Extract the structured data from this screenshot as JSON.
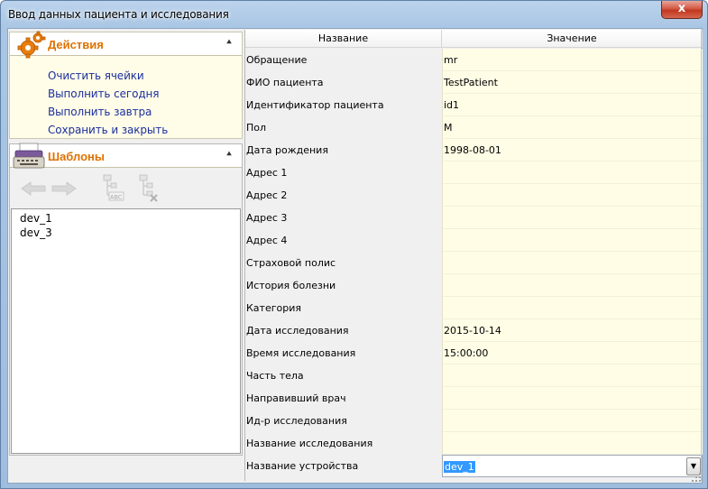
{
  "window": {
    "title": "Ввод данных пациента и исследования",
    "close_glyph": "x"
  },
  "actions": {
    "title": "Действия",
    "collapse_glyph": "⯅",
    "icon": "gears-icon",
    "items": [
      "Очистить ячейки",
      "Выполнить сегодня",
      "Выполнить завтра",
      "Сохранить и закрыть"
    ]
  },
  "templates": {
    "title": "Шаблоны",
    "collapse_glyph": "⯅",
    "icon": "typewriter-icon",
    "toolbar": [
      "back-arrow-icon",
      "forward-arrow-icon",
      "rename-template-icon",
      "delete-template-icon"
    ],
    "items": [
      "dev_1",
      "dev_3"
    ]
  },
  "grid": {
    "header_name": "Название",
    "header_value": "Значение",
    "rows": [
      {
        "name": "Обращение",
        "value": "mr"
      },
      {
        "name": "ФИО пациента",
        "value": "TestPatient"
      },
      {
        "name": "Идентификатор пациента",
        "value": "id1"
      },
      {
        "name": "Пол",
        "value": "M"
      },
      {
        "name": "Дата рождения",
        "value": "1998-08-01"
      },
      {
        "name": "Адрес 1",
        "value": ""
      },
      {
        "name": "Адрес 2",
        "value": ""
      },
      {
        "name": "Адрес 3",
        "value": ""
      },
      {
        "name": "Адрес 4",
        "value": ""
      },
      {
        "name": "Страховой полис",
        "value": ""
      },
      {
        "name": "История болезни",
        "value": ""
      },
      {
        "name": "Категория",
        "value": ""
      },
      {
        "name": "Дата исследования",
        "value": "2015-10-14"
      },
      {
        "name": "Время исследования",
        "value": "15:00:00"
      },
      {
        "name": "Часть тела",
        "value": ""
      },
      {
        "name": "Направивший врач",
        "value": ""
      },
      {
        "name": "Ид-р исследования",
        "value": ""
      },
      {
        "name": "Название исследования",
        "value": ""
      },
      {
        "name": "Название устройства",
        "value": "dev_1"
      }
    ],
    "dropdown_glyph": "▼",
    "colors": {
      "value_bg": "#fffde5",
      "selection": "#3399ff",
      "link": "#1c2f9e",
      "group_title": "#e07100"
    }
  }
}
